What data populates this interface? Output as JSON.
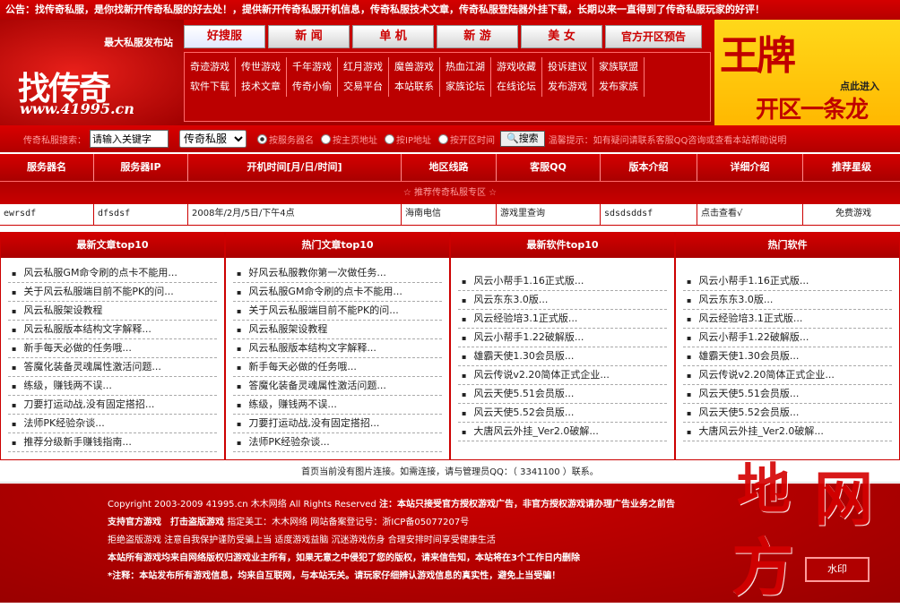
{
  "notice": "公告：找传奇私服，是你找新开传奇私服的好去处！，提供新开传奇私服开机信息，传奇私服技术文章，传奇私服登陆器外挂下载，长期以来一直得到了传奇私服玩家的好评！",
  "logo": {
    "slogan": "最大私服发布站",
    "name": "找传奇",
    "url": "www.41995.cn"
  },
  "tabs": [
    "好搜服",
    "新 闻",
    "单 机",
    "新 游",
    "美 女",
    "官方开区预告"
  ],
  "links_row1": [
    "奇迹游戏",
    "传世游戏",
    "千年游戏",
    "红月游戏",
    "魔兽游戏",
    "热血江湖",
    "游戏收藏",
    "投诉建议",
    "家族联盟"
  ],
  "links_row2": [
    "软件下载",
    "技术文章",
    "传奇小偷",
    "交易平台",
    "本站联系",
    "家族论坛",
    "在线论坛",
    "发布游戏",
    "发布家族"
  ],
  "ad": {
    "line1": "王牌",
    "line2": "点此进入",
    "line3": "开区一条龙"
  },
  "search": {
    "label": "传奇私服搜索：",
    "placeholder": "请输入关键字",
    "select": "传奇私服",
    "opts": [
      "按服务器名",
      "按主页地址",
      "按IP地址",
      "按开区时间"
    ],
    "button": "搜索",
    "tip": "温馨提示：如有疑问请联系客服QQ咨询或查看本站帮助说明"
  },
  "table": {
    "headers": [
      "服务器名",
      "服务器IP",
      "开机时间[月/日/时间]",
      "地区线路",
      "客服QQ",
      "版本介绍",
      "详细介绍",
      "推荐星级"
    ],
    "sub": "☆ 推荐传奇私服专区 ☆",
    "row": [
      "ewrsdf",
      "dfsdsf",
      "2008年/2月/5日/下午4点",
      "海南电信",
      "游戏里查询",
      "sdsdsddsf",
      "点击查看√",
      "免费游戏"
    ]
  },
  "lists": [
    {
      "title": "最新文章top10",
      "items": [
        "风云私服GM命令刷的点卡不能用...",
        "关于风云私服端目前不能PK的问...",
        "风云私服架设教程",
        "风云私服版本结构文字解释...",
        "新手每天必做的任务哦...",
        "答魔化装备灵魂属性激活问题...",
        "练级，赚钱两不误...",
        "刀要打运动战,没有固定搭招...",
        "法师PK经验杂谈...",
        "推荐分级新手赚钱指南..."
      ]
    },
    {
      "title": "热门文章top10",
      "items": [
        "好风云私服教你第一次做任务...",
        "风云私服GM命令刷的点卡不能用...",
        "关于风云私服端目前不能PK的问...",
        "风云私服架设教程",
        "风云私服版本结构文字解释...",
        "新手每天必做的任务哦...",
        "答魔化装备灵魂属性激活问题...",
        "练级，赚钱两不误...",
        "刀要打运动战,没有固定搭招...",
        "法师PK经验杂谈..."
      ]
    },
    {
      "title": "最新软件top10",
      "items": [
        "风云小帮手1.16正式版...",
        "风云东东3.0版...",
        "风云经验培3.1正式版...",
        "风云小帮手1.22破解版...",
        "雄霸天使1.30会员版...",
        "风云传说v2.20简体正式企业...",
        "风云天使5.51会员版...",
        "风云天使5.52会员版...",
        "大唐风云外挂_Ver2.0破解..."
      ]
    },
    {
      "title": "热门软件",
      "items": [
        "风云小帮手1.16正式版...",
        "风云东东3.0版...",
        "风云经验培3.1正式版...",
        "风云小帮手1.22破解版...",
        "雄霸天使1.30会员版...",
        "风云传说v2.20简体正式企业...",
        "风云天使5.51会员版...",
        "风云天使5.52会员版...",
        "大唐风云外挂_Ver2.0破解..."
      ]
    }
  ],
  "img_note": "首页当前没有图片连接。如需连接，请与管理员QQ：（ 3341100 ）联系。",
  "footer": {
    "copyright": "Copyright 2003-2009 41995.cn 木木网络 All Rights Reserved",
    "warn": "注：本站只接受官方授权游戏广告，非官方授权游戏请办理广告业务之前告",
    "l2a": "支持官方游戏　打击盗版游戏",
    "l2b": "指定美工：木木网络 网站备案登记号：浙ICP备05077207号",
    "l3": "拒绝盗版游戏 注意自我保护谨防受骗上当 适度游戏益脑 沉迷游戏伤身 合理安排时间享受健康生活",
    "l4": "本站所有游戏均来自网络版权归游戏业主所有，如果无意之中侵犯了您的版权，请来信告知，本站将在3个工作日内删除",
    "l5": "*注释：本站发布所有游戏信息，均来自互联网，与本站无关。请玩家仔细辨认游戏信息的真实性，避免上当受骗！"
  },
  "watermark": {
    "a": "地",
    "b": "网",
    "c": "方",
    "seal": "水印"
  }
}
